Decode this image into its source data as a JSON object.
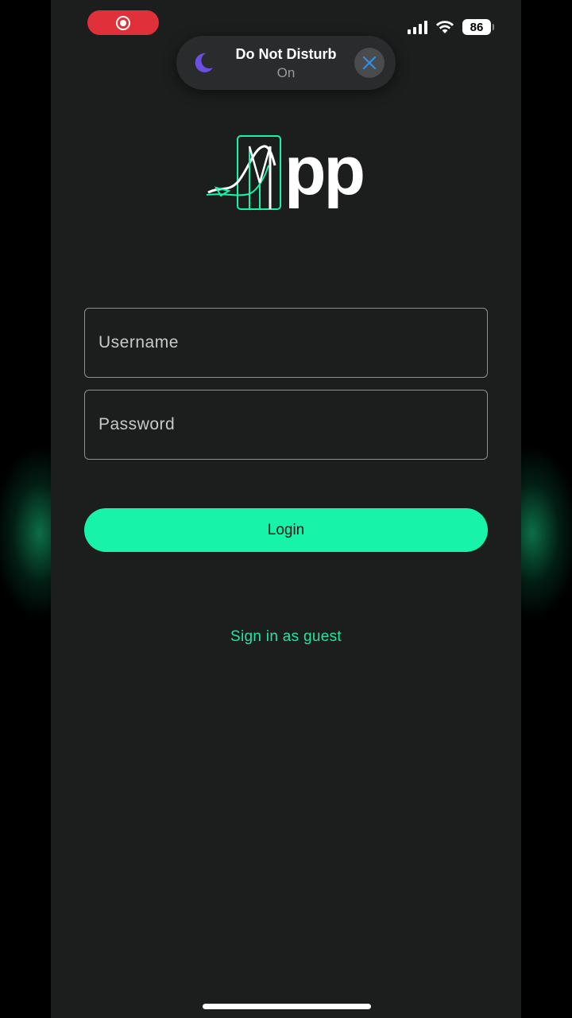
{
  "status_bar": {
    "battery_level": "86",
    "recording": true
  },
  "dnd_banner": {
    "title": "Do Not Disturb",
    "subtitle": "On",
    "icon": "moon-icon",
    "close_icon": "close-icon"
  },
  "logo": {
    "text": "pp"
  },
  "form": {
    "username_placeholder": "Username",
    "username_value": "",
    "password_placeholder": "Password",
    "password_value": "",
    "login_label": "Login",
    "guest_label": "Sign in as guest"
  },
  "colors": {
    "accent": "#17f3a9",
    "link": "#27e3a0",
    "background": "#1c1d1d",
    "record": "#e0303a",
    "moon": "#6b4fe0"
  }
}
